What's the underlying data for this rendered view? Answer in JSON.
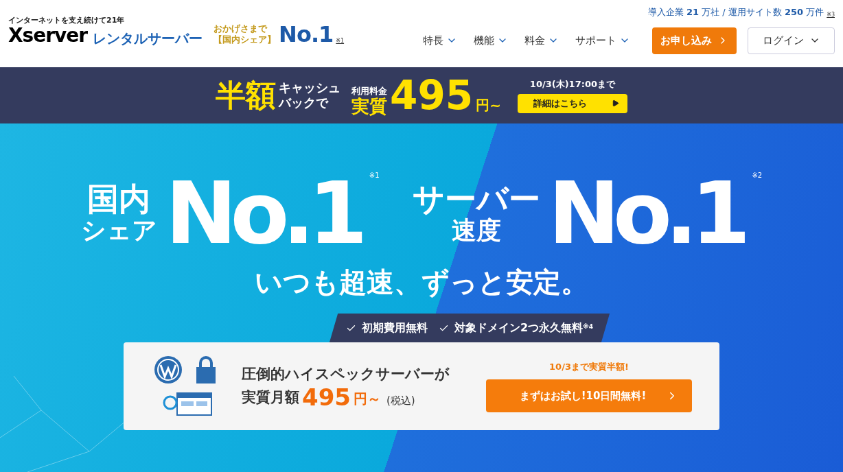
{
  "header": {
    "tagline": "インターネットを支え続けて**21**年",
    "logo": "Xserver",
    "product": "レンタルサーバー",
    "award": {
      "lines": [
        "おかげさまで",
        "【国内シェア】"
      ],
      "rank": "No.1",
      "note": "※1"
    },
    "stats": "導入企業 **21** 万社 / 運用サイト数 **250** 万件",
    "stats_note": "※3"
  },
  "nav": [
    {
      "label": "特長"
    },
    {
      "label": "機能"
    },
    {
      "label": "料金"
    },
    {
      "label": "サポート"
    }
  ],
  "apply_button": "お申し込み",
  "login_button": "ログイン",
  "banner": {
    "big": "半額",
    "lines": [
      "キャッシュ",
      "バックで"
    ],
    "fee_label": "利用料金",
    "fee_prefix": "実質",
    "price": "495",
    "unit": "円~",
    "deadline": "10/3(木)17:00まで",
    "details_button": "詳細はこちら"
  },
  "hero": {
    "blocks": [
      {
        "lines": [
          "国内",
          "シェア"
        ],
        "rank": "No.1",
        "note": "※1"
      },
      {
        "lines": [
          "サーバー",
          "速度"
        ],
        "rank": "No.1",
        "note": "※2"
      }
    ],
    "slogan": "いつも超速、ずっと安定。"
  },
  "features": [
    "初期費用**無料**",
    "対象ドメイン**2つ永久無料**$^{※4}$"
  ],
  "card": {
    "headline": "圧倒的ハイスペックサーバーが",
    "price_label": "実質月額",
    "price": "495",
    "unit": "円～",
    "tax": "(税込)",
    "promo": "10/3まで実質半額!",
    "cta": "まずはお試し!10日間無料!"
  }
}
